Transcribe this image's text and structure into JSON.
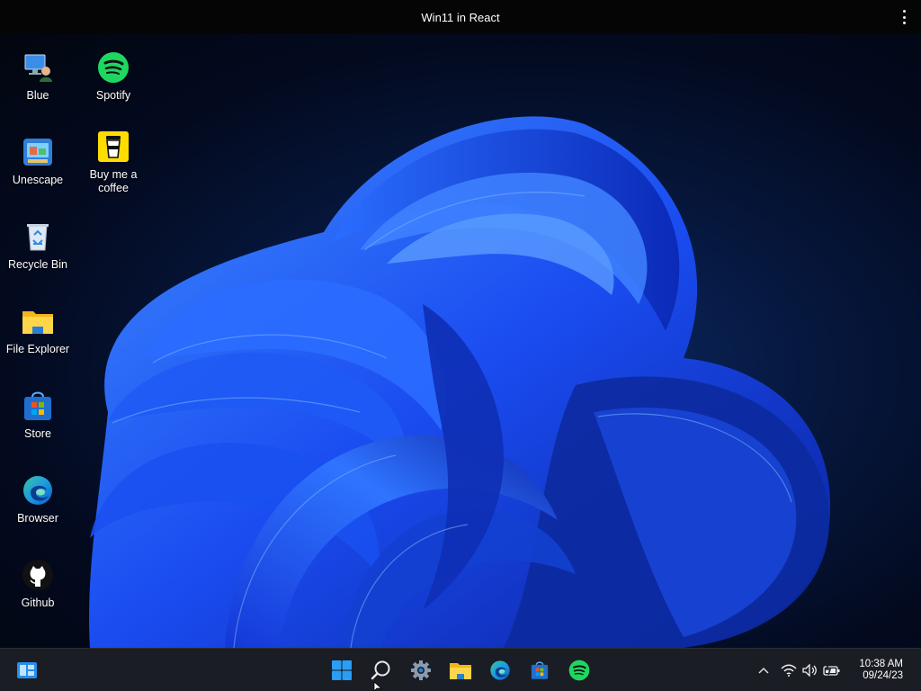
{
  "browser": {
    "title": "Win11 in React"
  },
  "desktop": {
    "icons": [
      {
        "label": "Blue",
        "icon": "blue-pc-icon"
      },
      {
        "label": "Spotify",
        "icon": "spotify-icon"
      },
      {
        "label": "Unescape",
        "icon": "unescape-icon"
      },
      {
        "label": "Buy me a coffee",
        "icon": "coffee-cup-icon"
      },
      {
        "label": "Recycle Bin",
        "icon": "recycle-bin-icon"
      },
      {
        "label": "File Explorer",
        "icon": "folder-icon"
      },
      {
        "label": "Store",
        "icon": "store-icon"
      },
      {
        "label": "Browser",
        "icon": "edge-icon"
      },
      {
        "label": "Github",
        "icon": "github-icon"
      }
    ]
  },
  "taskbar": {
    "widgets_icon": "widgets-icon",
    "pinned": [
      "windows-start-icon",
      "search-icon",
      "settings-gear-icon",
      "file-explorer-icon",
      "edge-icon",
      "store-icon",
      "spotify-icon"
    ],
    "tray": [
      "chevron-up-icon",
      "wifi-icon",
      "volume-icon",
      "battery-icon"
    ],
    "time": "10:38 AM",
    "date": "09/24/23"
  },
  "colors": {
    "accent": "#1f5fff",
    "taskbar": "#1b1d24",
    "spotify": "#1ed760"
  }
}
